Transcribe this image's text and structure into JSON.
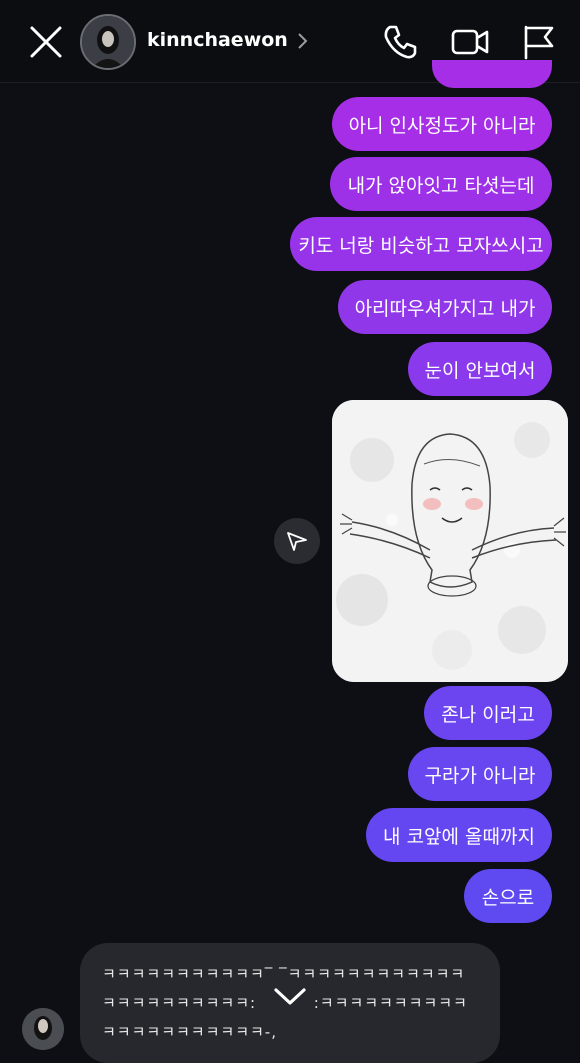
{
  "header": {
    "username": "kinnchaewon"
  },
  "messages": [
    {
      "text": "아니 인사정도가 아니라"
    },
    {
      "text": "내가 앉아잇고 타셧는데"
    },
    {
      "text": "키도 너랑 비슷하고 모자쓰시고"
    },
    {
      "text": "아리따우셔가지고 내가"
    },
    {
      "text": "눈이 안보여서"
    },
    {
      "text": "존나 이러고"
    },
    {
      "text": "구라가 아니라"
    },
    {
      "text": "내 코앞에 올때까지"
    },
    {
      "text": "손으로"
    }
  ],
  "incoming": {
    "line1": "ㅋㅋㅋㅋㅋㅋㅋㅋㅋㅋㅋ‾ ‾ㅋㅋㅋㅋㅋㅋㅋㅋㅋㅋㅋㅋ",
    "line2": "ㅋㅋㅋㅋㅋㅋㅋㅋㅋㅋ:          :ㅋㅋㅋㅋㅋㅋㅋㅋㅋㅋ",
    "line3": "ㅋㅋㅋㅋㅋㅋㅋㅋㅋㅋㅋ-,"
  },
  "colors": {
    "bubble_top": "#a52ee6",
    "bubble_mid": "#7b3ef2",
    "bubble_bottom": "#5f49f0",
    "background": "#0d0f14",
    "incoming_bg": "#26282d"
  },
  "icons": [
    "close-icon",
    "chevron-right-icon",
    "phone-icon",
    "video-call-icon",
    "flag-icon",
    "share-icon",
    "chevron-down-icon"
  ]
}
